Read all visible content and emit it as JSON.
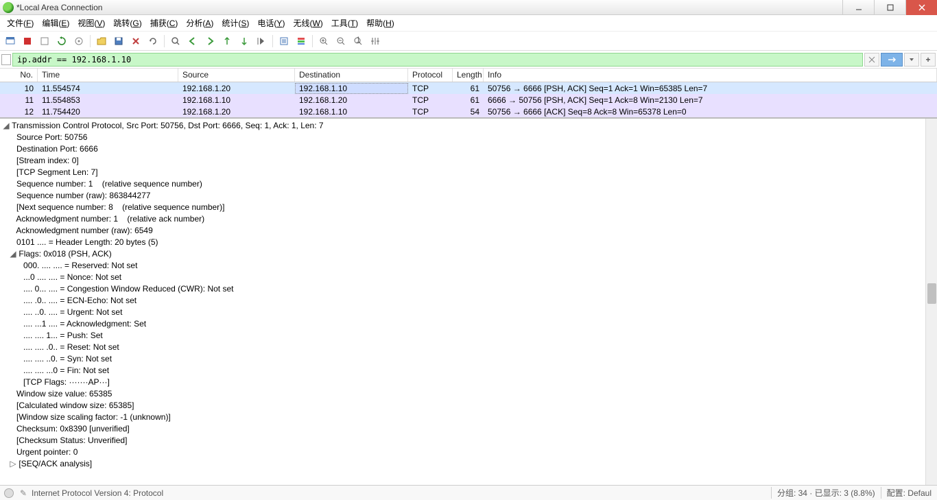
{
  "window": {
    "title": "*Local Area Connection"
  },
  "menu": {
    "items": [
      {
        "label": "文件",
        "u": "F"
      },
      {
        "label": "编辑",
        "u": "E"
      },
      {
        "label": "视图",
        "u": "V"
      },
      {
        "label": "跳转",
        "u": "G"
      },
      {
        "label": "捕获",
        "u": "C"
      },
      {
        "label": "分析",
        "u": "A"
      },
      {
        "label": "统计",
        "u": "S"
      },
      {
        "label": "电话",
        "u": "Y"
      },
      {
        "label": "无线",
        "u": "W"
      },
      {
        "label": "工具",
        "u": "T"
      },
      {
        "label": "帮助",
        "u": "H"
      }
    ]
  },
  "filter": {
    "value": "ip.addr == 192.168.1.10"
  },
  "columns": {
    "no": "No.",
    "time": "Time",
    "src": "Source",
    "dst": "Destination",
    "proto": "Protocol",
    "len": "Length",
    "info": "Info"
  },
  "packets": [
    {
      "no": "10",
      "time": "11.554574",
      "src": "192.168.1.20",
      "dst": "192.168.1.10",
      "proto": "TCP",
      "len": "61",
      "info": "50756 → 6666 [PSH, ACK] Seq=1 Ack=1 Win=65385 Len=7",
      "sel": true
    },
    {
      "no": "11",
      "time": "11.554853",
      "src": "192.168.1.10",
      "dst": "192.168.1.20",
      "proto": "TCP",
      "len": "61",
      "info": "6666 → 50756 [PSH, ACK] Seq=1 Ack=8 Win=2130 Len=7"
    },
    {
      "no": "12",
      "time": "11.754420",
      "src": "192.168.1.20",
      "dst": "192.168.1.10",
      "proto": "TCP",
      "len": "54",
      "info": "50756 → 6666 [ACK] Seq=8 Ack=8 Win=65378 Len=0"
    }
  ],
  "details": {
    "header": "Transmission Control Protocol, Src Port: 50756, Dst Port: 6666, Seq: 1, Ack: 1, Len: 7",
    "l1": "Source Port: 50756",
    "l2": "Destination Port: 6666",
    "l3": "[Stream index: 0]",
    "l4": "[TCP Segment Len: 7]",
    "l5": "Sequence number: 1    (relative sequence number)",
    "l6": "Sequence number (raw): 863844277",
    "l7": "[Next sequence number: 8    (relative sequence number)]",
    "l8": "Acknowledgment number: 1    (relative ack number)",
    "l9": "Acknowledgment number (raw): 6549",
    "l10": "0101 .... = Header Length: 20 bytes (5)",
    "flags_hdr": "Flags: 0x018 (PSH, ACK)",
    "f1": "000. .... .... = Reserved: Not set",
    "f2": "...0 .... .... = Nonce: Not set",
    "f3": ".... 0... .... = Congestion Window Reduced (CWR): Not set",
    "f4": ".... .0.. .... = ECN-Echo: Not set",
    "f5": ".... ..0. .... = Urgent: Not set",
    "f6": ".... ...1 .... = Acknowledgment: Set",
    "f7": ".... .... 1... = Push: Set",
    "f8": ".... .... .0.. = Reset: Not set",
    "f9": ".... .... ..0. = Syn: Not set",
    "f10": ".... .... ...0 = Fin: Not set",
    "f11": "[TCP Flags: ·······AP···]",
    "w1": "Window size value: 65385",
    "w2": "[Calculated window size: 65385]",
    "w3": "[Window size scaling factor: -1 (unknown)]",
    "w4": "Checksum: 0x8390 [unverified]",
    "w5": "[Checksum Status: Unverified]",
    "w6": "Urgent pointer: 0",
    "w7": "[SEQ/ACK analysis]"
  },
  "status": {
    "left": "Internet Protocol Version 4: Protocol",
    "mid": "分组: 34 · 已显示: 3 (8.8%)",
    "right": "配置: Defaul"
  }
}
